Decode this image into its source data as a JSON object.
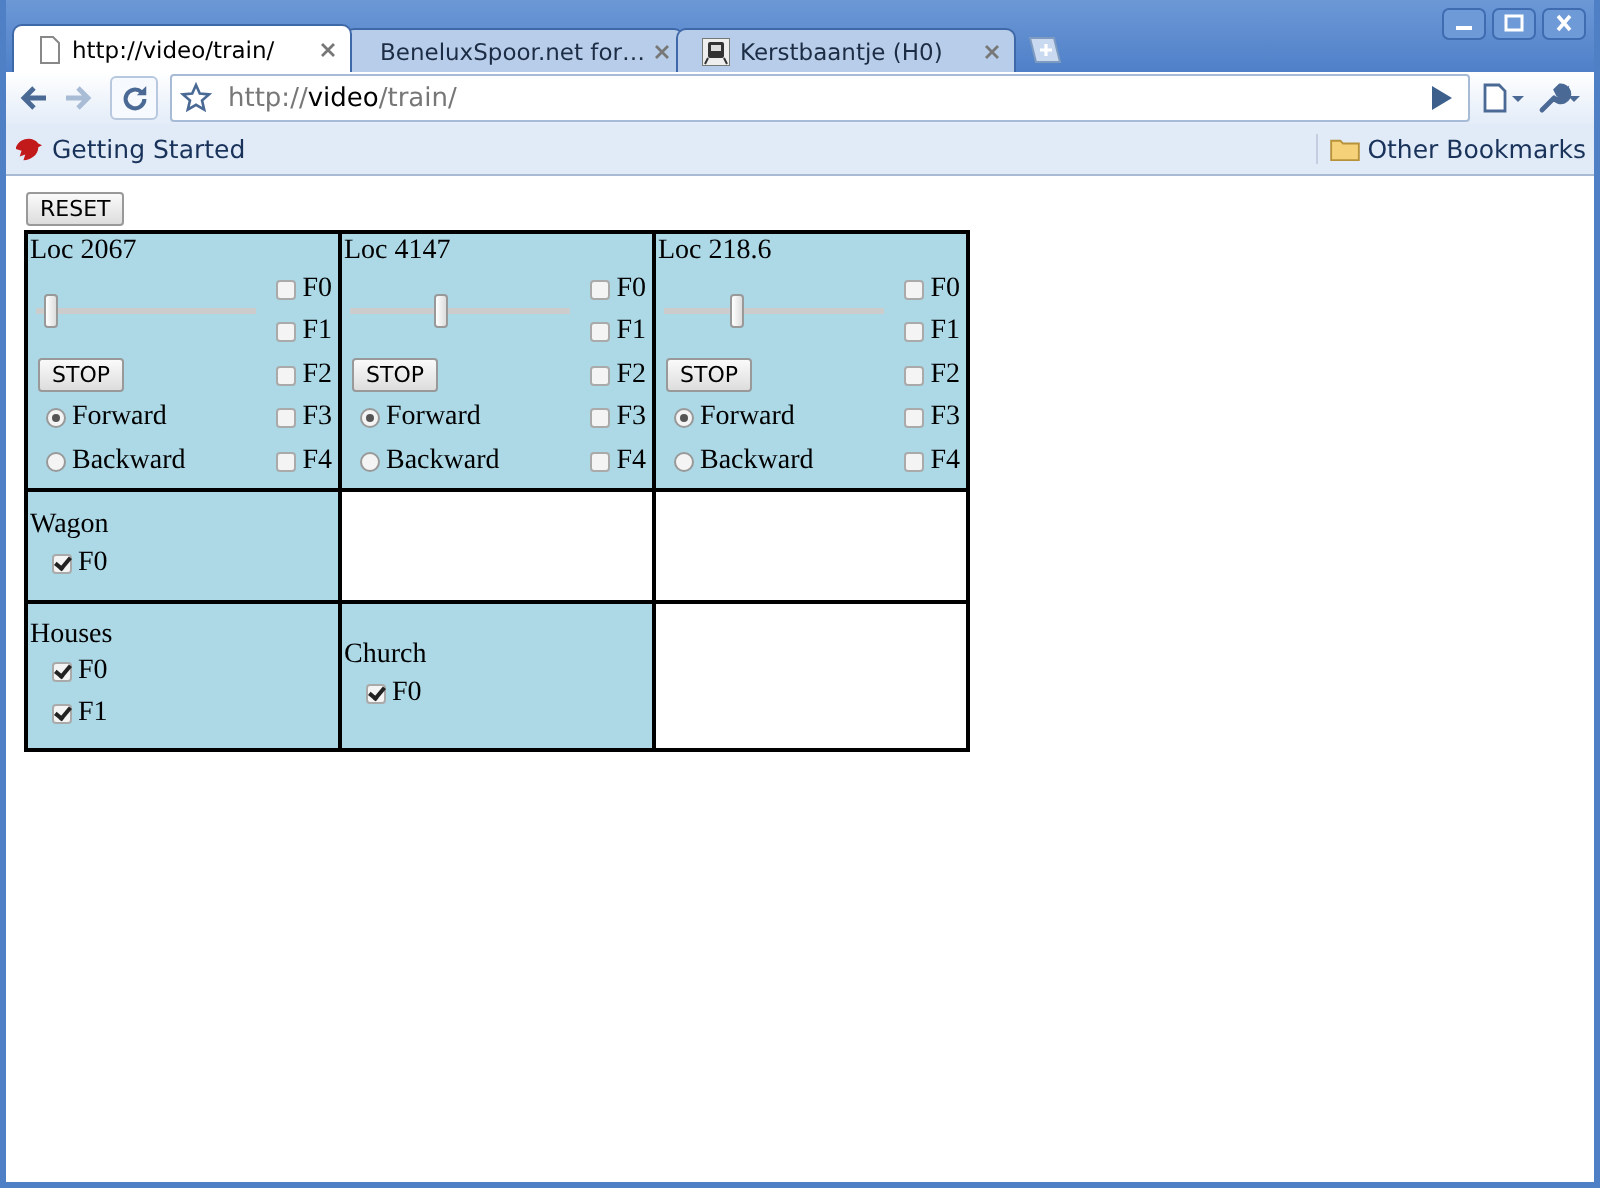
{
  "browser": {
    "tabs": [
      {
        "title": "http://video/train/",
        "selected": true
      },
      {
        "title": "BeneluxSpoor.net for…",
        "selected": false
      },
      {
        "title": "Kerstbaantje (H0)",
        "selected": false
      }
    ],
    "address": {
      "scheme": "http://",
      "host": "video",
      "path": "/train/"
    },
    "nav": {
      "back_disabled": false,
      "forward_disabled": true
    },
    "bookmarks": [
      {
        "label": "Getting Started"
      }
    ],
    "other_bookmarks": "Other Bookmarks"
  },
  "page": {
    "reset_button": "RESET",
    "rows": [
      [
        {
          "kind": "loco",
          "name": "Loc 2067",
          "level": 0.04,
          "stop_button": "STOP",
          "directions": [
            {
              "label": "Forward",
              "selected": true
            },
            {
              "label": "Backward",
              "selected": false
            }
          ],
          "functions": [
            {
              "label": "F0",
              "checked": false
            },
            {
              "label": "F1",
              "checked": false
            },
            {
              "label": "F2",
              "checked": false
            },
            {
              "label": "F3",
              "checked": false
            },
            {
              "label": "F4",
              "checked": false
            }
          ]
        },
        {
          "kind": "loco",
          "name": "Loc 4147",
          "level": 0.38,
          "stop_button": "STOP",
          "directions": [
            {
              "label": "Forward",
              "selected": true
            },
            {
              "label": "Backward",
              "selected": false
            }
          ],
          "functions": [
            {
              "label": "F0",
              "checked": false
            },
            {
              "label": "F1",
              "checked": false
            },
            {
              "label": "F2",
              "checked": false
            },
            {
              "label": "F3",
              "checked": false
            },
            {
              "label": "F4",
              "checked": false
            }
          ]
        },
        {
          "kind": "loco",
          "name": "Loc 218.6",
          "level": 0.3,
          "stop_button": "STOP",
          "directions": [
            {
              "label": "Forward",
              "selected": true
            },
            {
              "label": "Backward",
              "selected": false
            }
          ],
          "functions": [
            {
              "label": "F0",
              "checked": false
            },
            {
              "label": "F1",
              "checked": false
            },
            {
              "label": "F2",
              "checked": false
            },
            {
              "label": "F3",
              "checked": false
            },
            {
              "label": "F4",
              "checked": false
            }
          ]
        }
      ],
      [
        {
          "kind": "accessory",
          "name": "Wagon",
          "functions": [
            {
              "label": "F0",
              "checked": true
            }
          ]
        },
        {
          "kind": "empty"
        },
        {
          "kind": "empty"
        }
      ],
      [
        {
          "kind": "accessory",
          "name": "Houses",
          "functions": [
            {
              "label": "F0",
              "checked": true
            },
            {
              "label": "F1",
              "checked": true
            }
          ]
        },
        {
          "kind": "accessory",
          "name": "Church",
          "functions": [
            {
              "label": "F0",
              "checked": true
            }
          ]
        },
        {
          "kind": "empty"
        }
      ]
    ]
  }
}
